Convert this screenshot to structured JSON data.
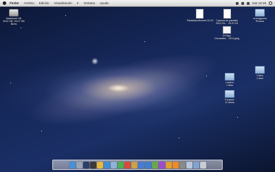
{
  "menubar": {
    "app_name": "Finder",
    "items": [
      "Archivo",
      "Edición",
      "Visualización",
      "Ir",
      "Ventana",
      "Ayuda"
    ],
    "right_text": "mar 10:18"
  },
  "desktop_icons": {
    "hdd": {
      "label": "Macintosh HD",
      "sub": "2012 GB, 18,07 GB libres"
    },
    "doc1": {
      "label": "PantallazoHome9.20.20"
    },
    "doc2": {
      "label": "Captura de pantalla",
      "sub": "2012-03-... 23.07.03"
    },
    "folder1": {
      "label": "vs imágenes",
      "sub": "Printout"
    },
    "img1": {
      "label": "El Nipo",
      "sub": "Cervantes... 2011.jpeg"
    },
    "folder2": {
      "label": "Vídeo",
      "sub": "1 ítem"
    },
    "folder3": {
      "label": "Ladera",
      "sub": "1 ítem"
    },
    "folder4": {
      "label": "Ecuador",
      "sub": "11 ítems"
    }
  },
  "dock": {
    "apps": [
      {
        "name": "finder-icon",
        "color": "#4a90d9"
      },
      {
        "name": "launchpad-icon",
        "color": "#9aa5b5"
      },
      {
        "name": "mission-control-icon",
        "color": "#2b3e6b"
      },
      {
        "name": "dashboard-icon",
        "color": "#3a3a3a"
      },
      {
        "name": "chrome-icon",
        "color": "#e8b83a"
      },
      {
        "name": "safari-icon",
        "color": "#3d8fd6"
      },
      {
        "name": "mail-icon",
        "color": "#8fb2d8"
      },
      {
        "name": "facetime-icon",
        "color": "#4caf50"
      },
      {
        "name": "calendar-icon",
        "color": "#d84a3a"
      },
      {
        "name": "photos-icon",
        "color": "#c9a24a"
      },
      {
        "name": "itunes-icon",
        "color": "#4b7bd1"
      },
      {
        "name": "appstore-icon",
        "color": "#3f7fd0"
      },
      {
        "name": "preview-icon",
        "color": "#6aa84f"
      },
      {
        "name": "itunes-music-icon",
        "color": "#a04ad0"
      },
      {
        "name": "garageband-icon",
        "color": "#e0a030"
      },
      {
        "name": "vlc-icon",
        "color": "#f08a24"
      },
      {
        "name": "preferences-icon",
        "color": "#8a8a8a"
      },
      {
        "name": "documents-stack-icon",
        "color": "#b8c7dc"
      },
      {
        "name": "downloads-stack-icon",
        "color": "#7fa4cf"
      },
      {
        "name": "trash-icon",
        "color": "#c9cdd3"
      }
    ]
  }
}
